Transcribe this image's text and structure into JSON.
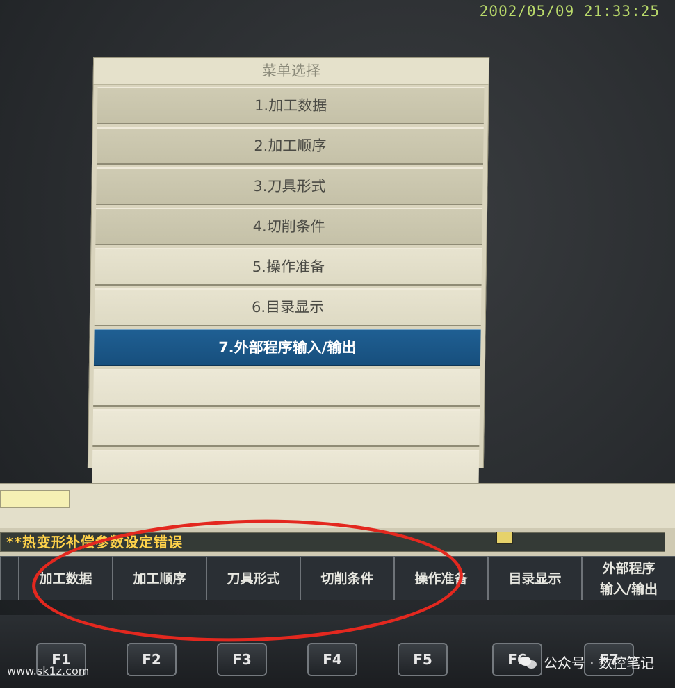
{
  "clock": "2002/05/09 21:33:25",
  "menu": {
    "title": "菜单选择",
    "items": [
      {
        "label": "1.加工数据"
      },
      {
        "label": "2.加工顺序"
      },
      {
        "label": "3.刀具形式"
      },
      {
        "label": "4.切削条件"
      },
      {
        "label": "5.操作准备"
      },
      {
        "label": "6.目录显示"
      },
      {
        "label": "7.外部程序输入/输出"
      }
    ],
    "selected_index": 6
  },
  "message": "**热变形补偿参数设定错误",
  "softkeys": [
    {
      "label": "加工数据"
    },
    {
      "label": "加工顺序"
    },
    {
      "label": "刀具形式"
    },
    {
      "label": "切削条件"
    },
    {
      "label": "操作准备"
    },
    {
      "label": "目录显示"
    },
    {
      "label": "外部程序\n输入/输出"
    }
  ],
  "function_keys": [
    "F1",
    "F2",
    "F3",
    "F4",
    "F5",
    "F6",
    "F7"
  ],
  "watermark": {
    "site": "www.sk1z.com",
    "account": "公众号 · 数控笔记"
  },
  "colors": {
    "selected": "#1f5f93",
    "message_text": "#ffd24a",
    "clock": "#b9d96a",
    "annotation": "#e3281f"
  }
}
